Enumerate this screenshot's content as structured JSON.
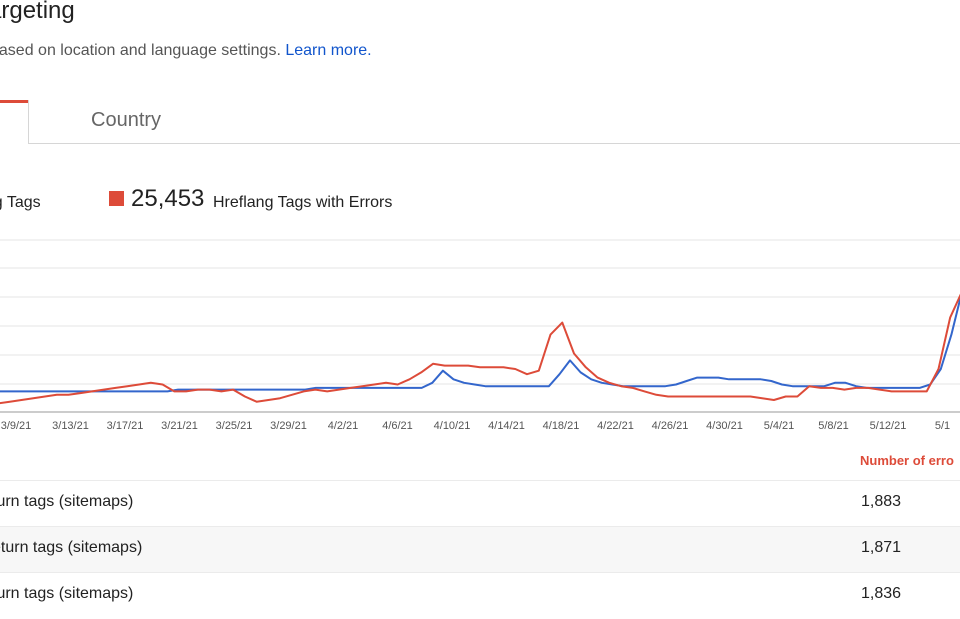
{
  "page": {
    "title": "argeting",
    "description": "based on location and language settings.",
    "learn_more": "Learn more."
  },
  "tabs": [
    {
      "label": "",
      "active": true
    },
    {
      "label": "Country",
      "active": false
    }
  ],
  "legend": {
    "left_label": "ang Tags",
    "errors_value": "25,453",
    "errors_label": "Hreflang Tags with Errors",
    "errors_color": "#dd4b39",
    "tags_color": "#3366cc"
  },
  "chart_data": {
    "type": "line",
    "x_tick_labels": [
      "3/9/21",
      "3/13/21",
      "3/17/21",
      "3/21/21",
      "3/25/21",
      "3/29/21",
      "4/2/21",
      "4/6/21",
      "4/10/21",
      "4/14/21",
      "4/18/21",
      "4/22/21",
      "4/26/21",
      "4/30/21",
      "5/4/21",
      "5/8/21",
      "5/12/21",
      "5/1"
    ],
    "grid": true,
    "series": [
      {
        "color": "#3366cc",
        "values": [
          12,
          12,
          12,
          12,
          12,
          12,
          12,
          12,
          12,
          12,
          12,
          12,
          12,
          12,
          12,
          12,
          12,
          13,
          13,
          13,
          13,
          13,
          13,
          13,
          13,
          13,
          13,
          13,
          13,
          13,
          14,
          14,
          14,
          14,
          14,
          14,
          14,
          14,
          14,
          14,
          14,
          17,
          24,
          19,
          17,
          16,
          15,
          15,
          15,
          15,
          15,
          15,
          15,
          22,
          30,
          23,
          19,
          17,
          16,
          15,
          15,
          15,
          15,
          15,
          16,
          18,
          20,
          20,
          20,
          19,
          19,
          19,
          19,
          18,
          16,
          15,
          15,
          15,
          15,
          17,
          17,
          15,
          14,
          14,
          14,
          14,
          14,
          14,
          16,
          25,
          45,
          70
        ]
      },
      {
        "color": "#dd4b39",
        "values": [
          5,
          6,
          7,
          8,
          9,
          10,
          10,
          11,
          12,
          13,
          14,
          15,
          16,
          17,
          16,
          12,
          12,
          13,
          13,
          12,
          13,
          9,
          6,
          7,
          8,
          10,
          12,
          13,
          12,
          13,
          14,
          15,
          16,
          17,
          16,
          19,
          23,
          28,
          27,
          27,
          27,
          26,
          26,
          26,
          25,
          22,
          24,
          45,
          52,
          34,
          26,
          20,
          17,
          15,
          14,
          12,
          10,
          9,
          9,
          9,
          9,
          9,
          9,
          9,
          9,
          8,
          7,
          9,
          9,
          15,
          14,
          14,
          13,
          14,
          14,
          13,
          12,
          12,
          12,
          12,
          25,
          55,
          70
        ]
      }
    ],
    "ylim": [
      0,
      100
    ]
  },
  "table": {
    "header": "Number of erro",
    "rows": [
      {
        "name": "turn tags (sitemaps)",
        "value": "1,883"
      },
      {
        "name": "eturn tags (sitemaps)",
        "value": "1,871"
      },
      {
        "name": "turn tags (sitemaps)",
        "value": "1,836"
      }
    ]
  }
}
